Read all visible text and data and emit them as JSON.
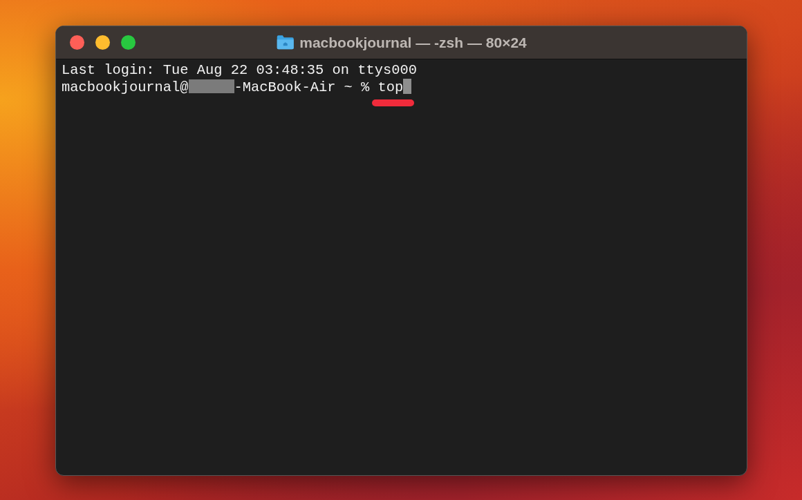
{
  "window": {
    "title": "macbookjournal — -zsh — 80×24"
  },
  "terminal": {
    "lines": [
      "Last login: Tue Aug 22 03:48:35 on ttys000"
    ],
    "prompt": {
      "user": "macbookjournal@",
      "host_rest": "-MacBook-Air ~ % ",
      "command": "top"
    }
  }
}
